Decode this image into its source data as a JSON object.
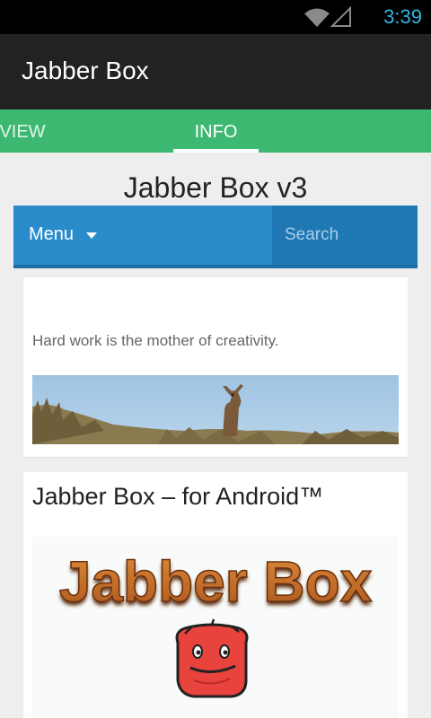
{
  "status_bar": {
    "time": "3:39",
    "icons": [
      "wifi-icon",
      "signal-icon"
    ]
  },
  "app": {
    "title": "Jabber Box"
  },
  "tabs": [
    {
      "label": "VIEW",
      "selected": false
    },
    {
      "label": "INFO",
      "selected": true
    }
  ],
  "page": {
    "site_title": "Jabber Box v3",
    "nav": {
      "menu_label": "Menu",
      "search_placeholder": "Search"
    },
    "card1": {
      "quote": "Hard work is the mother of creativity.",
      "image": "deer-banner-image"
    },
    "card2": {
      "title": "Jabber Box – for Android™",
      "logo_text": "Jabber Box"
    }
  },
  "colors": {
    "tab_bar": "#3cb870",
    "nav_bar": "#2a8ccb",
    "clock": "#33b5e5",
    "action_bar": "#222222"
  }
}
